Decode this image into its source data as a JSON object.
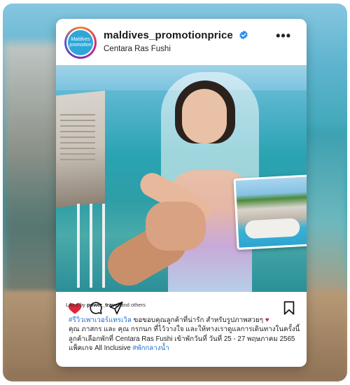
{
  "post": {
    "username": "maldives_promotionprice",
    "location": "Centara Ras Fushi",
    "avatar_text": "Maldives promotion",
    "liked_by_prefix": "Liked by ",
    "liked_by_user": "power_travel",
    "liked_by_suffix": " and others",
    "caption": {
      "hashtag1": "#รีวิวเพาเวอร์แทรเวิล",
      "line1": " ขอขอบคุณลูกค้าที่น่ารัก สำหรับรูปภาพสวยๆ ",
      "heart": "♥",
      "line2": "คุณ ภาสกร และ คุณ กรกนก ที่ไว้วางใจ และให้ทางเราดูแลการเดินทางในครั้งนี้",
      "line3": "ลูกค้าเลือกพักที่ Centara Ras Fushi เข้าพักวันที่ วันที่ 25 - 27 พฤษภาคม 2565",
      "line4": "แพ็คเกจ All Inclusive ",
      "hashtag2": "#พักกลางน้ำ"
    }
  },
  "icons": {
    "verified": "verified-badge-icon",
    "more": "more-options-icon",
    "like": "heart-icon",
    "comment": "comment-icon",
    "share": "share-icon",
    "save": "bookmark-icon"
  },
  "colors": {
    "like": "#e0243a",
    "hashtag": "#1f6fd1",
    "verified": "#2f8ef0"
  }
}
